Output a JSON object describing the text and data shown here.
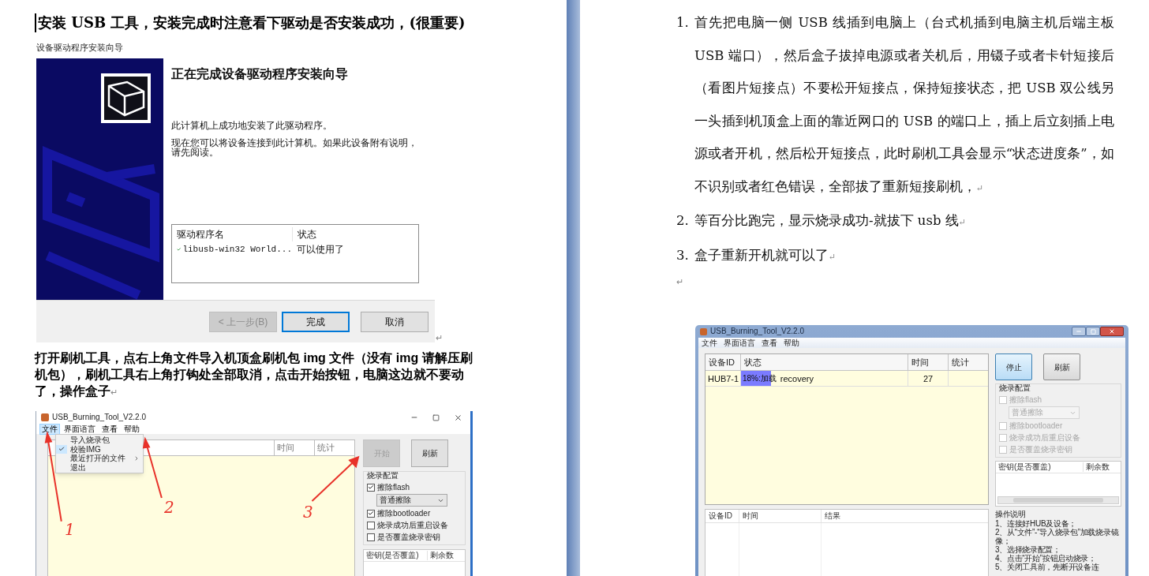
{
  "left_page": {
    "heading": "安装 USB 工具，安装完成时注意看下驱动是否安装成功，(很重要)",
    "wizard": {
      "caption": "设备驱动程序安装向导",
      "title": "正在完成设备驱动程序安装向导",
      "messages": [
        "此计算机上成功地安装了此驱动程序。",
        "现在您可以将设备连接到此计算机。如果此设备附有说明，请先阅读。"
      ],
      "table": {
        "columns": [
          "驱动程序名",
          "状态"
        ],
        "rows": [
          {
            "name": "libusb-win32 World...",
            "status": "可以使用了",
            "ok": true
          }
        ]
      },
      "buttons": [
        {
          "label": "< 上一步(B)",
          "disabled": true,
          "default": false
        },
        {
          "label": "完成",
          "disabled": false,
          "default": true
        },
        {
          "label": "取消",
          "disabled": false,
          "default": false
        }
      ],
      "mark": "↵"
    },
    "paragraph": {
      "text": "打开刷机工具，点右上角文件导入机顶盒刷机包 img 文件（没有 img 请解压刷机包），刷机工具右上角打钩处全部取消，点击开始按钮，电脑这边就不要动了，操作盒子",
      "mark": "↵"
    },
    "tool": {
      "title": "USB_Burning_Tool_V2.2.0",
      "menu": [
        {
          "label": "文件",
          "selected": true
        },
        {
          "label": "界面语言",
          "selected": false
        },
        {
          "label": "查看",
          "selected": false
        },
        {
          "label": "帮助",
          "selected": false
        }
      ],
      "dropdown": [
        {
          "label": "导入烧录包",
          "checked": false,
          "submenu": false
        },
        {
          "label": "校验IMG",
          "checked": true,
          "submenu": false
        },
        {
          "label": "最近打开的文件",
          "checked": false,
          "submenu": true
        },
        {
          "label": "退出",
          "checked": false,
          "submenu": false
        }
      ],
      "columns": [
        "时间",
        "统计"
      ],
      "buttons": [
        {
          "label": "开始",
          "disabled": true
        },
        {
          "label": "刷新",
          "disabled": false
        }
      ],
      "config": {
        "title": "烧录配置",
        "options": [
          {
            "kind": "checkbox",
            "label": "擦除flash",
            "checked": true,
            "disabled": false
          },
          {
            "kind": "select",
            "value": "普通擦除",
            "disabled": false
          },
          {
            "kind": "checkbox",
            "label": "擦除bootloader",
            "checked": true,
            "disabled": false
          },
          {
            "kind": "checkbox",
            "label": "烧录成功后重启设备",
            "checked": false,
            "disabled": false
          },
          {
            "kind": "checkbox",
            "label": "是否覆盖烧录密钥",
            "checked": false,
            "disabled": false
          }
        ]
      },
      "key_columns": [
        "密钥(是否覆盖)",
        "剩余数"
      ],
      "annotations": [
        "1",
        "2",
        "3"
      ]
    }
  },
  "right_page": {
    "list": [
      {
        "marker": "1.",
        "text": "首先把电脑一侧 USB 线插到电脑上（台式机插到电脑主机后端主板 USB 端口），然后盒子拔掉电源或者关机后，用镊子或者卡针短接后（看图片短接点）不要松开短接点，保持短接状态，把 USB 双公线另一头插到机顶盒上面的靠近网口的 USB 的端口上，插上后立刻插上电源或者开机，然后松开短接点，此时刷机工具会显示“状态进度条”，如不识别或者红色错误，全部拔了重新短接刷机，",
        "mark": "↵"
      },
      {
        "marker": "2.",
        "text": "等百分比跑完，显示烧录成功-就拔下 usb 线",
        "mark": "↵"
      },
      {
        "marker": "3.",
        "text": "盒子重新开机就可以了",
        "mark": "↵"
      }
    ],
    "empty_mark": "↵",
    "tool": {
      "title": "USB_Burning_Tool_V2.2.0",
      "menu": [
        "文件",
        "界面语言",
        "查看",
        "帮助"
      ],
      "columns": [
        "设备ID",
        "状态",
        "时间",
        "统计"
      ],
      "rows": [
        {
          "device": "HUB7-1",
          "progress": "18%:加载",
          "level": 0.18,
          "status": "recovery",
          "time": "27"
        }
      ],
      "buttons": [
        {
          "label": "停止",
          "focused": true
        },
        {
          "label": "刷新",
          "focused": false
        }
      ],
      "config": {
        "title": "烧录配置",
        "options": [
          {
            "kind": "checkbox",
            "label": "擦除flash",
            "checked": false,
            "disabled": true
          },
          {
            "kind": "select",
            "value": "普通擦除",
            "disabled": true
          },
          {
            "kind": "checkbox",
            "label": "擦除bootloader",
            "checked": false,
            "disabled": true
          },
          {
            "kind": "checkbox",
            "label": "烧录成功后重启设备",
            "checked": false,
            "disabled": true
          },
          {
            "kind": "checkbox",
            "label": "是否覆盖烧录密钥",
            "checked": false,
            "disabled": true
          }
        ]
      },
      "key_columns": [
        "密钥(是否覆盖)",
        "剩余数"
      ],
      "log_columns": [
        "设备ID",
        "时间",
        "结果"
      ],
      "instructions": {
        "title": "操作说明",
        "items": [
          "1、连接好HUB及设备；",
          "2、从“文件”-“导入烧录包”加载烧录镜像；",
          "3、选择烧录配置；",
          "4、点击“开始”按钮启动烧录；",
          "5、关闭工具前，先断开设备连"
        ]
      }
    }
  }
}
